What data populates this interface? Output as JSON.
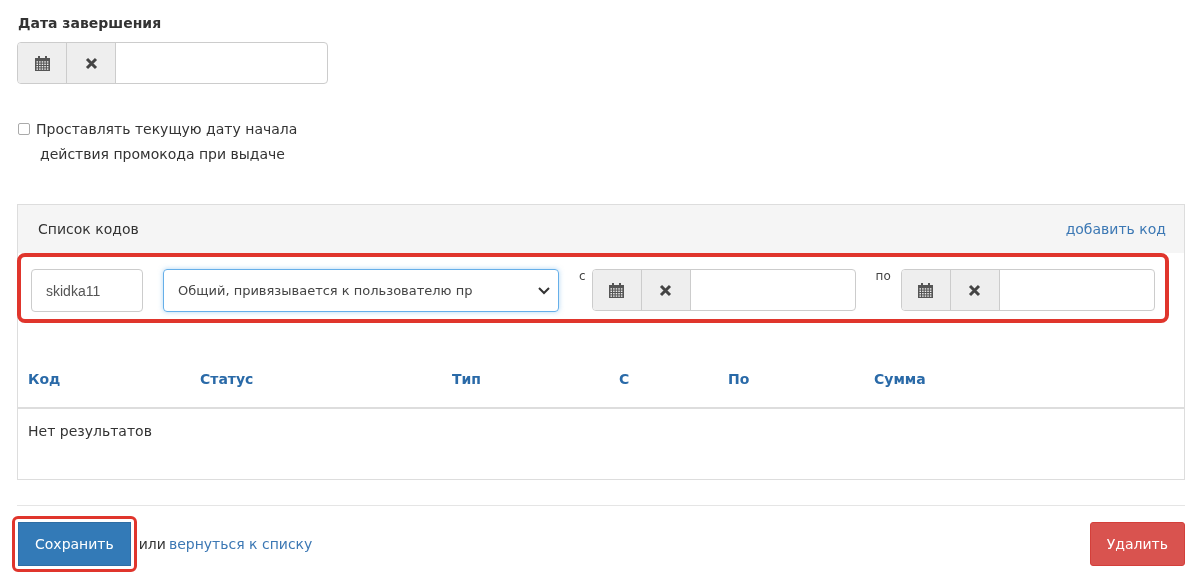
{
  "end_date": {
    "label": "Дата завершения"
  },
  "auto_start_date": {
    "label_line1": "Проставлять текущую дату начала",
    "label_line2": "действия промокода при выдаче",
    "checked": false
  },
  "codes_panel": {
    "title": "Список кодов",
    "add_link": "добавить код",
    "new_code": {
      "highlighted": true,
      "code": "skidka11",
      "type": "Общий, привязывается к пользователю пр",
      "from_label": "с",
      "to_label": "по"
    },
    "table": {
      "columns": [
        "Код",
        "Статус",
        "Тип",
        "С",
        "По",
        "Сумма"
      ],
      "empty_text": "Нет результатов"
    }
  },
  "footer": {
    "save": {
      "label": "Сохранить",
      "highlighted": true
    },
    "or_text": "или",
    "back_link": "вернуться к списку",
    "delete": "Удалить"
  }
}
